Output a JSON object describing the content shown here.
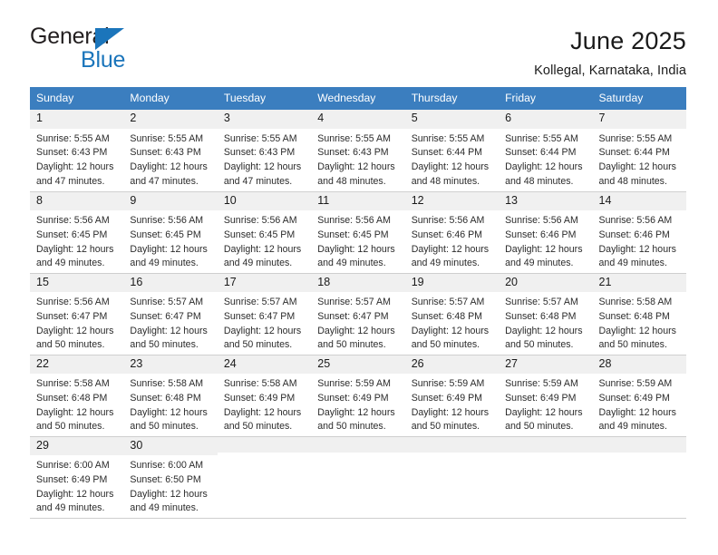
{
  "brand": {
    "line1": "General",
    "line2": "Blue",
    "triangle_color": "#1b75bb",
    "text_color": "#231f20"
  },
  "header": {
    "title": "June 2025",
    "subtitle": "Kollegal, Karnataka, India"
  },
  "theme": {
    "header_bg": "#3b7ebf",
    "header_text": "#ffffff",
    "daynum_bg": "#f0f0f0",
    "row_border": "#cfcfcf"
  },
  "weekdays": [
    "Sunday",
    "Monday",
    "Tuesday",
    "Wednesday",
    "Thursday",
    "Friday",
    "Saturday"
  ],
  "weeks": [
    [
      {
        "day": "1",
        "sunrise": "Sunrise: 5:55 AM",
        "sunset": "Sunset: 6:43 PM",
        "daylight1": "Daylight: 12 hours",
        "daylight2": "and 47 minutes."
      },
      {
        "day": "2",
        "sunrise": "Sunrise: 5:55 AM",
        "sunset": "Sunset: 6:43 PM",
        "daylight1": "Daylight: 12 hours",
        "daylight2": "and 47 minutes."
      },
      {
        "day": "3",
        "sunrise": "Sunrise: 5:55 AM",
        "sunset": "Sunset: 6:43 PM",
        "daylight1": "Daylight: 12 hours",
        "daylight2": "and 47 minutes."
      },
      {
        "day": "4",
        "sunrise": "Sunrise: 5:55 AM",
        "sunset": "Sunset: 6:43 PM",
        "daylight1": "Daylight: 12 hours",
        "daylight2": "and 48 minutes."
      },
      {
        "day": "5",
        "sunrise": "Sunrise: 5:55 AM",
        "sunset": "Sunset: 6:44 PM",
        "daylight1": "Daylight: 12 hours",
        "daylight2": "and 48 minutes."
      },
      {
        "day": "6",
        "sunrise": "Sunrise: 5:55 AM",
        "sunset": "Sunset: 6:44 PM",
        "daylight1": "Daylight: 12 hours",
        "daylight2": "and 48 minutes."
      },
      {
        "day": "7",
        "sunrise": "Sunrise: 5:55 AM",
        "sunset": "Sunset: 6:44 PM",
        "daylight1": "Daylight: 12 hours",
        "daylight2": "and 48 minutes."
      }
    ],
    [
      {
        "day": "8",
        "sunrise": "Sunrise: 5:56 AM",
        "sunset": "Sunset: 6:45 PM",
        "daylight1": "Daylight: 12 hours",
        "daylight2": "and 49 minutes."
      },
      {
        "day": "9",
        "sunrise": "Sunrise: 5:56 AM",
        "sunset": "Sunset: 6:45 PM",
        "daylight1": "Daylight: 12 hours",
        "daylight2": "and 49 minutes."
      },
      {
        "day": "10",
        "sunrise": "Sunrise: 5:56 AM",
        "sunset": "Sunset: 6:45 PM",
        "daylight1": "Daylight: 12 hours",
        "daylight2": "and 49 minutes."
      },
      {
        "day": "11",
        "sunrise": "Sunrise: 5:56 AM",
        "sunset": "Sunset: 6:45 PM",
        "daylight1": "Daylight: 12 hours",
        "daylight2": "and 49 minutes."
      },
      {
        "day": "12",
        "sunrise": "Sunrise: 5:56 AM",
        "sunset": "Sunset: 6:46 PM",
        "daylight1": "Daylight: 12 hours",
        "daylight2": "and 49 minutes."
      },
      {
        "day": "13",
        "sunrise": "Sunrise: 5:56 AM",
        "sunset": "Sunset: 6:46 PM",
        "daylight1": "Daylight: 12 hours",
        "daylight2": "and 49 minutes."
      },
      {
        "day": "14",
        "sunrise": "Sunrise: 5:56 AM",
        "sunset": "Sunset: 6:46 PM",
        "daylight1": "Daylight: 12 hours",
        "daylight2": "and 49 minutes."
      }
    ],
    [
      {
        "day": "15",
        "sunrise": "Sunrise: 5:56 AM",
        "sunset": "Sunset: 6:47 PM",
        "daylight1": "Daylight: 12 hours",
        "daylight2": "and 50 minutes."
      },
      {
        "day": "16",
        "sunrise": "Sunrise: 5:57 AM",
        "sunset": "Sunset: 6:47 PM",
        "daylight1": "Daylight: 12 hours",
        "daylight2": "and 50 minutes."
      },
      {
        "day": "17",
        "sunrise": "Sunrise: 5:57 AM",
        "sunset": "Sunset: 6:47 PM",
        "daylight1": "Daylight: 12 hours",
        "daylight2": "and 50 minutes."
      },
      {
        "day": "18",
        "sunrise": "Sunrise: 5:57 AM",
        "sunset": "Sunset: 6:47 PM",
        "daylight1": "Daylight: 12 hours",
        "daylight2": "and 50 minutes."
      },
      {
        "day": "19",
        "sunrise": "Sunrise: 5:57 AM",
        "sunset": "Sunset: 6:48 PM",
        "daylight1": "Daylight: 12 hours",
        "daylight2": "and 50 minutes."
      },
      {
        "day": "20",
        "sunrise": "Sunrise: 5:57 AM",
        "sunset": "Sunset: 6:48 PM",
        "daylight1": "Daylight: 12 hours",
        "daylight2": "and 50 minutes."
      },
      {
        "day": "21",
        "sunrise": "Sunrise: 5:58 AM",
        "sunset": "Sunset: 6:48 PM",
        "daylight1": "Daylight: 12 hours",
        "daylight2": "and 50 minutes."
      }
    ],
    [
      {
        "day": "22",
        "sunrise": "Sunrise: 5:58 AM",
        "sunset": "Sunset: 6:48 PM",
        "daylight1": "Daylight: 12 hours",
        "daylight2": "and 50 minutes."
      },
      {
        "day": "23",
        "sunrise": "Sunrise: 5:58 AM",
        "sunset": "Sunset: 6:48 PM",
        "daylight1": "Daylight: 12 hours",
        "daylight2": "and 50 minutes."
      },
      {
        "day": "24",
        "sunrise": "Sunrise: 5:58 AM",
        "sunset": "Sunset: 6:49 PM",
        "daylight1": "Daylight: 12 hours",
        "daylight2": "and 50 minutes."
      },
      {
        "day": "25",
        "sunrise": "Sunrise: 5:59 AM",
        "sunset": "Sunset: 6:49 PM",
        "daylight1": "Daylight: 12 hours",
        "daylight2": "and 50 minutes."
      },
      {
        "day": "26",
        "sunrise": "Sunrise: 5:59 AM",
        "sunset": "Sunset: 6:49 PM",
        "daylight1": "Daylight: 12 hours",
        "daylight2": "and 50 minutes."
      },
      {
        "day": "27",
        "sunrise": "Sunrise: 5:59 AM",
        "sunset": "Sunset: 6:49 PM",
        "daylight1": "Daylight: 12 hours",
        "daylight2": "and 50 minutes."
      },
      {
        "day": "28",
        "sunrise": "Sunrise: 5:59 AM",
        "sunset": "Sunset: 6:49 PM",
        "daylight1": "Daylight: 12 hours",
        "daylight2": "and 49 minutes."
      }
    ],
    [
      {
        "day": "29",
        "sunrise": "Sunrise: 6:00 AM",
        "sunset": "Sunset: 6:49 PM",
        "daylight1": "Daylight: 12 hours",
        "daylight2": "and 49 minutes."
      },
      {
        "day": "30",
        "sunrise": "Sunrise: 6:00 AM",
        "sunset": "Sunset: 6:50 PM",
        "daylight1": "Daylight: 12 hours",
        "daylight2": "and 49 minutes."
      },
      {
        "day": "",
        "sunrise": "",
        "sunset": "",
        "daylight1": "",
        "daylight2": ""
      },
      {
        "day": "",
        "sunrise": "",
        "sunset": "",
        "daylight1": "",
        "daylight2": ""
      },
      {
        "day": "",
        "sunrise": "",
        "sunset": "",
        "daylight1": "",
        "daylight2": ""
      },
      {
        "day": "",
        "sunrise": "",
        "sunset": "",
        "daylight1": "",
        "daylight2": ""
      },
      {
        "day": "",
        "sunrise": "",
        "sunset": "",
        "daylight1": "",
        "daylight2": ""
      }
    ]
  ]
}
